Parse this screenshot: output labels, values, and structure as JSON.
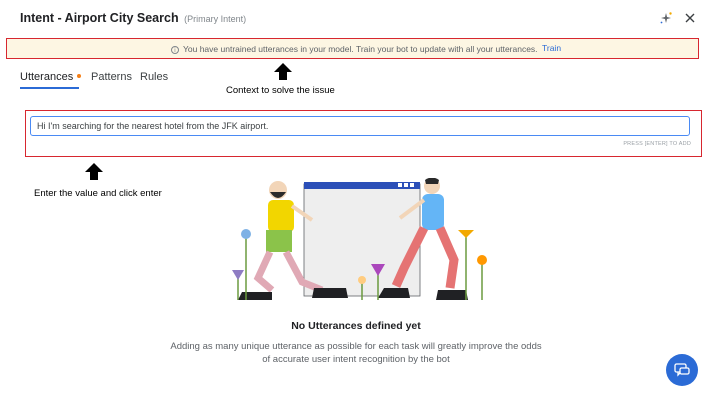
{
  "header": {
    "title": "Intent - Airport City Search",
    "subtitle": "(Primary Intent)"
  },
  "banner": {
    "message": "You have untrained utterances in your model. Train your bot to update with all your utterances.",
    "action": "Train"
  },
  "annotations": {
    "context": "Context to solve the issue",
    "enter": "Enter the value and click enter"
  },
  "tabs": [
    {
      "label": "Utterances",
      "active": true,
      "dot": true
    },
    {
      "label": "Patterns",
      "active": false
    },
    {
      "label": "Rules",
      "active": false
    }
  ],
  "utterance_input": {
    "value": "Hi I'm searching for the nearest hotel from the JFK airport.",
    "hint": "PRESS [ENTER] TO ADD"
  },
  "empty_state": {
    "title": "No Utterances defined yet",
    "description": "Adding as many unique utterance as possible for each task will greatly improve the odds of accurate user intent recognition by the bot"
  },
  "colors": {
    "accent": "#2b6bd6",
    "highlight_border": "#d7272f",
    "banner_bg": "#fdf6e3",
    "tab_dot": "#f57f17"
  },
  "icons": {
    "sparkle": "sparkle-icon",
    "close": "close-icon",
    "info": "info-icon",
    "chat": "chat-icon"
  }
}
